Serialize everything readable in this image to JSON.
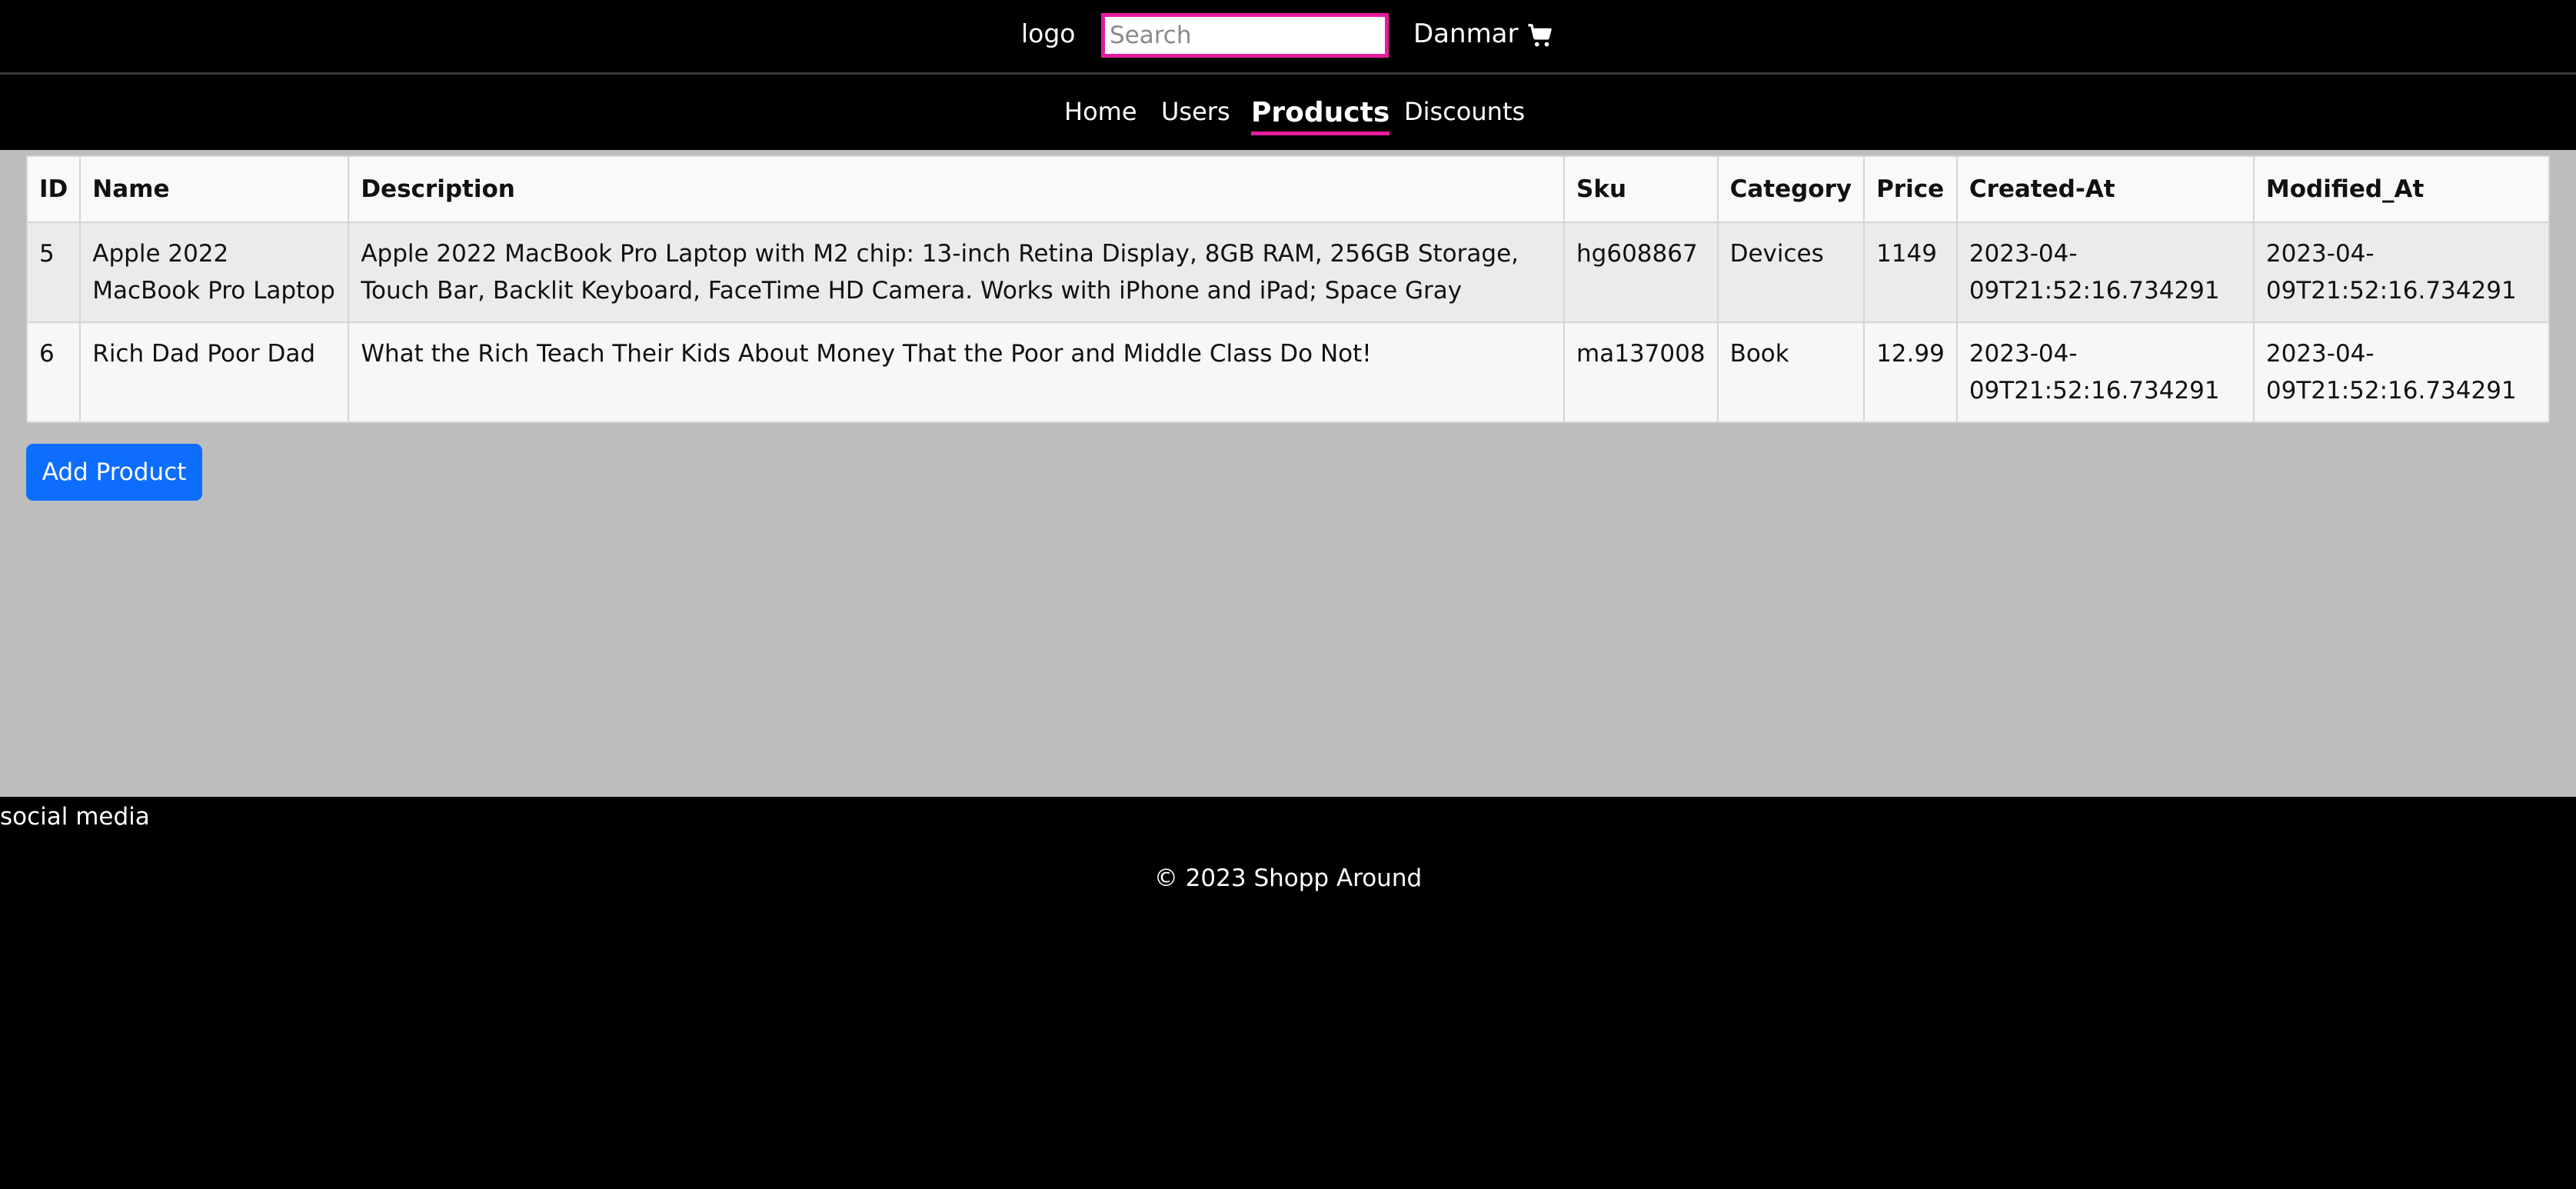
{
  "header": {
    "logo": "logo",
    "search_placeholder": "Search",
    "user_name": "Danmar",
    "cart_icon": "shopping-cart-icon"
  },
  "nav": {
    "items": [
      "Home",
      "Users",
      "Products",
      "Discounts"
    ],
    "active": "Products"
  },
  "table": {
    "headers": [
      "ID",
      "Name",
      "Description",
      "Sku",
      "Category",
      "Price",
      "Created-At",
      "Modified_At"
    ],
    "rows": [
      [
        "5",
        "Apple 2022 MacBook Pro Laptop",
        "Apple 2022 MacBook Pro Laptop with M2 chip: 13-inch Retina Display, 8GB RAM, 256GB Storage, Touch Bar, Backlit Keyboard, FaceTime HD Camera. Works with iPhone and iPad; Space Gray",
        "hg608867",
        "Devices",
        "1149",
        "2023-04-09T21:52:16.734291",
        "2023-04-09T21:52:16.734291"
      ],
      [
        "6",
        "Rich Dad Poor Dad",
        "What the Rich Teach Their Kids About Money That the Poor and Middle Class Do Not!",
        "ma137008",
        "Book",
        "12.99",
        "2023-04-09T21:52:16.734291",
        "2023-04-09T21:52:16.734291"
      ]
    ]
  },
  "actions": {
    "add_product": "Add Product"
  },
  "footer": {
    "social": "social media",
    "copyright": "© 2023 Shopp Around"
  },
  "colors": {
    "accent_pink": "#e61c9c",
    "button_blue": "#0d6efd"
  }
}
